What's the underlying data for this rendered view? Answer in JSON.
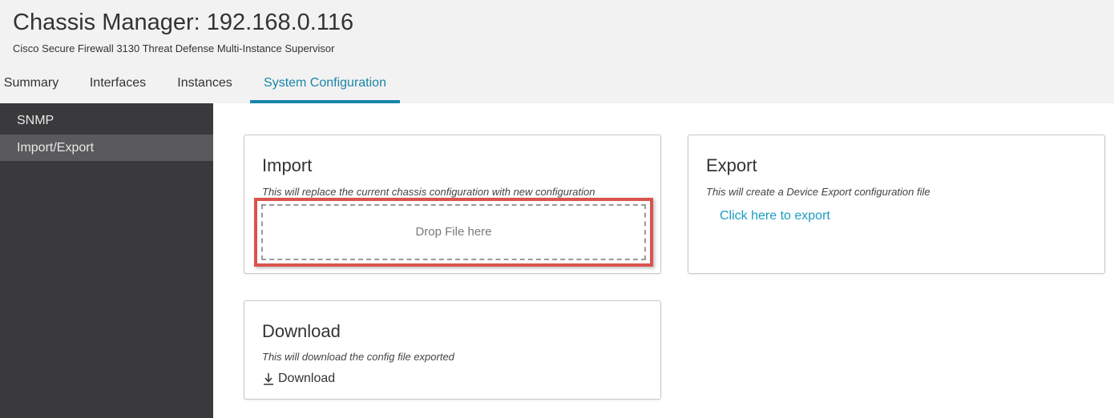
{
  "header": {
    "title": "Chassis Manager: 192.168.0.116",
    "subtitle": "Cisco Secure Firewall 3130 Threat Defense Multi-Instance Supervisor"
  },
  "tabs": [
    {
      "label": "Summary",
      "active": false
    },
    {
      "label": "Interfaces",
      "active": false
    },
    {
      "label": "Instances",
      "active": false
    },
    {
      "label": "System Configuration",
      "active": true
    }
  ],
  "sidebar": {
    "items": [
      {
        "label": "SNMP",
        "active": false
      },
      {
        "label": "Import/Export",
        "active": true
      }
    ]
  },
  "import_card": {
    "title": "Import",
    "description": "This will replace the current chassis configuration with new configuration",
    "drop_label": "Drop File here"
  },
  "export_card": {
    "title": "Export",
    "description": "This will create a Device Export configuration file",
    "link_label": "Click here to export"
  },
  "download_card": {
    "title": "Download",
    "description": "This will download the config file exported",
    "button_label": "Download",
    "icon": "download-icon"
  },
  "colors": {
    "accent": "#1a85a8",
    "link": "#1a9cc0",
    "highlight": "#d9534f",
    "sidebar_bg": "#3a3a3c",
    "sidebar_active_bg": "#5a5a5d",
    "header_bg": "#f2f2f2"
  }
}
